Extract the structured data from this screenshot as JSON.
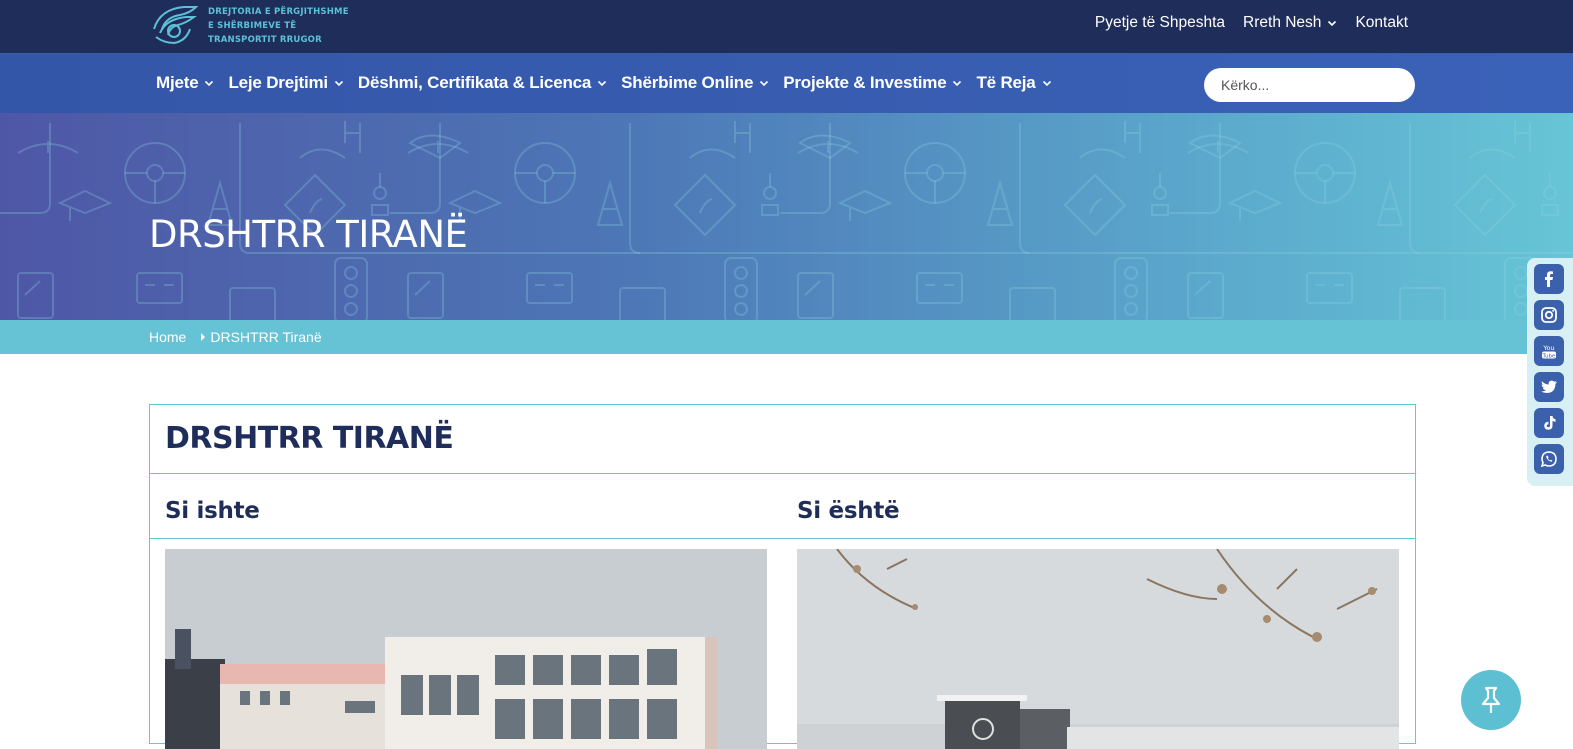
{
  "header": {
    "logo_lines": [
      "DREJTORIA E PËRGJITHSHME",
      "E SHËRBIMEVE TË",
      "TRANSPORTIT RRUGOR"
    ],
    "top_links": [
      "Pyetje të Shpeshta",
      "Rreth Nesh",
      "Kontakt"
    ]
  },
  "nav": {
    "items": [
      "Mjete",
      "Leje Drejtimi",
      "Dëshmi, Certifikata & Licenca",
      "Shërbime Online",
      "Projekte & Investime",
      "Të Reja"
    ],
    "search_placeholder": "Kërko..."
  },
  "hero": {
    "title": "DRSHTRR TIRANË"
  },
  "breadcrumb": {
    "home": "Home",
    "current": "DRSHTRR Tiranë"
  },
  "content": {
    "title": "DRSHTRR TIRANË",
    "col_left": "Si ishte",
    "col_right": "Si është"
  },
  "social": [
    "facebook-icon",
    "instagram-icon",
    "youtube-icon",
    "twitter-icon",
    "tiktok-icon",
    "whatsapp-icon"
  ],
  "colors": {
    "topbar": "#1f2d5a",
    "nav": "#3456a8",
    "accent": "#65c3d5"
  }
}
